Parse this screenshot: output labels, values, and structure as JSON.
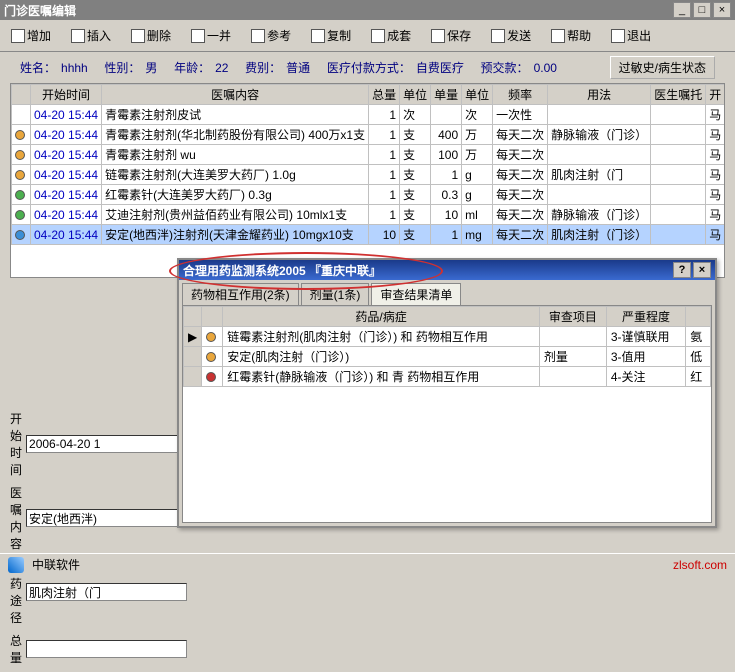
{
  "window": {
    "title": "门诊医嘱编辑"
  },
  "toolbar": {
    "add": "增加",
    "insert": "插入",
    "delete": "删除",
    "batch": "一并",
    "ref": "参考",
    "copy": "复制",
    "set": "成套",
    "save": "保存",
    "send": "发送",
    "help": "帮助",
    "exit": "退出"
  },
  "patient": {
    "name_l": "姓名：",
    "name": "hhhh",
    "sex_l": "性别：",
    "sex": "男",
    "age_l": "年龄：",
    "age": "22",
    "type_l": "费别：",
    "type": "普通",
    "pay_l": "医疗付款方式：",
    "pay": "自费医疗",
    "pre_l": "预交款：",
    "pre": "0.00",
    "hist_btn": "过敏史/病生状态"
  },
  "grid": {
    "headers": {
      "time": "开始时间",
      "content": "医嘱内容",
      "total": "总量",
      "u1": "单位",
      "single": "单量",
      "u2": "单位",
      "freq": "频率",
      "usage": "用法",
      "doctor": "医生嘱托",
      "start": "开"
    },
    "rows": [
      {
        "dot": "",
        "time": "04-20 15:44",
        "content": "青霉素注射剂皮试",
        "total": "1",
        "u1": "次",
        "single": "",
        "u2": "次",
        "freq": "一次性",
        "usage": "",
        "doctor": "",
        "start": "马"
      },
      {
        "dot": "#e9a63c",
        "time": "04-20 15:44",
        "content": "青霉素注射剂(华北制药股份有限公司) 400万x1支",
        "total": "1",
        "u1": "支",
        "single": "400",
        "u2": "万",
        "freq": "每天二次",
        "usage": "静脉输液（门诊）",
        "doctor": "",
        "start": "马"
      },
      {
        "dot": "#e9a63c",
        "time": "04-20 15:44",
        "content": "青霉素注射剂 wu",
        "total": "1",
        "u1": "支",
        "single": "100",
        "u2": "万",
        "freq": "每天二次",
        "usage": "",
        "doctor": "",
        "start": "马"
      },
      {
        "dot": "#e9a63c",
        "time": "04-20 15:44",
        "content": "链霉素注射剂(大连美罗大药厂) 1.0g",
        "total": "1",
        "u1": "支",
        "single": "1",
        "u2": "g",
        "freq": "每天二次",
        "usage": "肌肉注射（门",
        "doctor": "",
        "start": "马"
      },
      {
        "dot": "#4caf50",
        "time": "04-20 15:44",
        "content": "红霉素针(大连美罗大药厂) 0.3g",
        "total": "1",
        "u1": "支",
        "single": "0.3",
        "u2": "g",
        "freq": "每天二次",
        "usage": "",
        "doctor": "",
        "start": "马"
      },
      {
        "dot": "#4caf50",
        "time": "04-20 15:44",
        "content": "艾迪注射剂(贵州益佰药业有限公司) 10mlx1支",
        "total": "1",
        "u1": "支",
        "single": "10",
        "u2": "ml",
        "freq": "每天二次",
        "usage": "静脉输液（门诊）",
        "doctor": "",
        "start": "马"
      },
      {
        "dot": "#3b8ed6",
        "time": "04-20 15:44",
        "content": "安定(地西泮)注射剂(天津金耀药业) 10mgx10支",
        "total": "10",
        "u1": "支",
        "single": "1",
        "u2": "mg",
        "freq": "每天二次",
        "usage": "肌肉注射（门诊）",
        "doctor": "",
        "start": "马",
        "selected": true
      }
    ]
  },
  "form": {
    "start_l": "开始时间",
    "start_v": "2006-04-20 1",
    "content_l": "医嘱内容",
    "content_v": "安定(地西泮)",
    "route_l": "给药途径",
    "route_v": "肌肉注射（门",
    "total_l": "总量",
    "total_v": ""
  },
  "status": {
    "soft": "中联软件",
    "brand": "zlsoft.com"
  },
  "popup": {
    "title": "合理用药监测系统2005 『重庆中联』",
    "tabs": {
      "t1": "药物相互作用(2条)",
      "t2": "剂量(1条)",
      "t3": "审查结果清单"
    },
    "headers": {
      "drug": "药品/病症",
      "item": "审查项目",
      "sev": "严重程度",
      "tail": ""
    },
    "rows": [
      {
        "ptr": "▶",
        "dot": "#e9a63c",
        "drug": "链霉素注射剂(肌肉注射（门诊）) 和 药物相互作用",
        "item": "",
        "sev": "3-谨慎联用",
        "tail": "氨"
      },
      {
        "ptr": "",
        "dot": "#e9a63c",
        "drug": "安定(肌肉注射（门诊）)",
        "item": "剂量",
        "sev": "3-值用",
        "tail": "低"
      },
      {
        "ptr": "",
        "dot": "#c83232",
        "drug": "红霉素针(静脉输液（门诊）) 和 青 药物相互作用",
        "item": "",
        "sev": "4-关注",
        "tail": "红"
      }
    ]
  }
}
